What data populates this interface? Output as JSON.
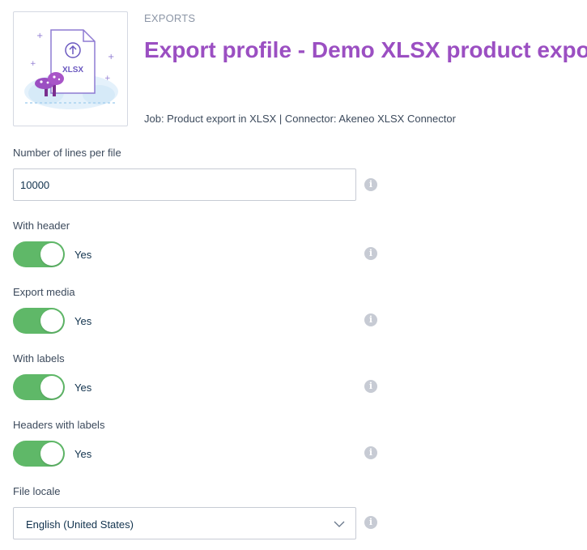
{
  "header": {
    "breadcrumb": "EXPORTS",
    "title": "Export profile - Demo XLSX product export",
    "meta": "Job: Product export in XLSX | Connector: Akeneo XLSX Connector",
    "illustration_text": "XLSX"
  },
  "fields": {
    "lines_per_file": {
      "label": "Number of lines per file",
      "value": "10000"
    },
    "with_header": {
      "label": "With header",
      "state": "Yes"
    },
    "export_media": {
      "label": "Export media",
      "state": "Yes"
    },
    "with_labels": {
      "label": "With labels",
      "state": "Yes"
    },
    "headers_with_labels": {
      "label": "Headers with labels",
      "state": "Yes"
    },
    "file_locale": {
      "label": "File locale",
      "value": "English (United States)"
    }
  },
  "icons": {
    "info": "info-icon",
    "dropdown": "chevron-down-icon",
    "illustration": "xlsx-file-export-illustration"
  },
  "colors": {
    "title": "#9b4fc2",
    "toggle_on": "#5fb868",
    "info_icon": "#c7cbd4",
    "border": "#c7cbd4"
  }
}
